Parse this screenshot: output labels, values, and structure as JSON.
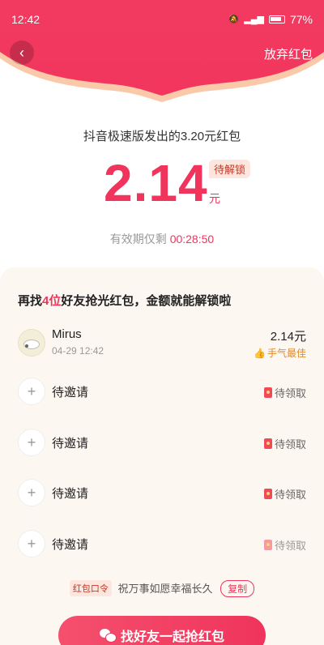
{
  "status_bar": {
    "time": "12:42",
    "battery": "77%"
  },
  "header": {
    "back_icon": "chevron-left-icon",
    "give_up_label": "放弃红包"
  },
  "packet": {
    "subtitle": "抖音极速版发出的3.20元红包",
    "amount": "2.14",
    "unit": "元",
    "badge": "待解锁",
    "expire_label": "有效期仅剩",
    "expire_countdown": "00:28:50"
  },
  "card": {
    "title_prefix": "再找",
    "title_highlight": "4位",
    "title_suffix": "好友抢光红包，金额就能解锁啦",
    "claimed": {
      "name": "Mirus",
      "date": "04-29 12:42",
      "amount": "2.14元",
      "tag": "手气最佳"
    },
    "invites": [
      {
        "label": "待邀请",
        "status": "待领取"
      },
      {
        "label": "待邀请",
        "status": "待领取"
      },
      {
        "label": "待邀请",
        "status": "待领取"
      },
      {
        "label": "待邀请",
        "status": "待领取"
      }
    ]
  },
  "password": {
    "tag": "红包口令",
    "text": "祝万事如愿幸福长久",
    "copy_label": "复制"
  },
  "cta": {
    "label": "找好友一起抢红包"
  },
  "colors": {
    "brand": "#f0345c",
    "header": "#f2365d",
    "card_bg": "#fdf7f1"
  }
}
